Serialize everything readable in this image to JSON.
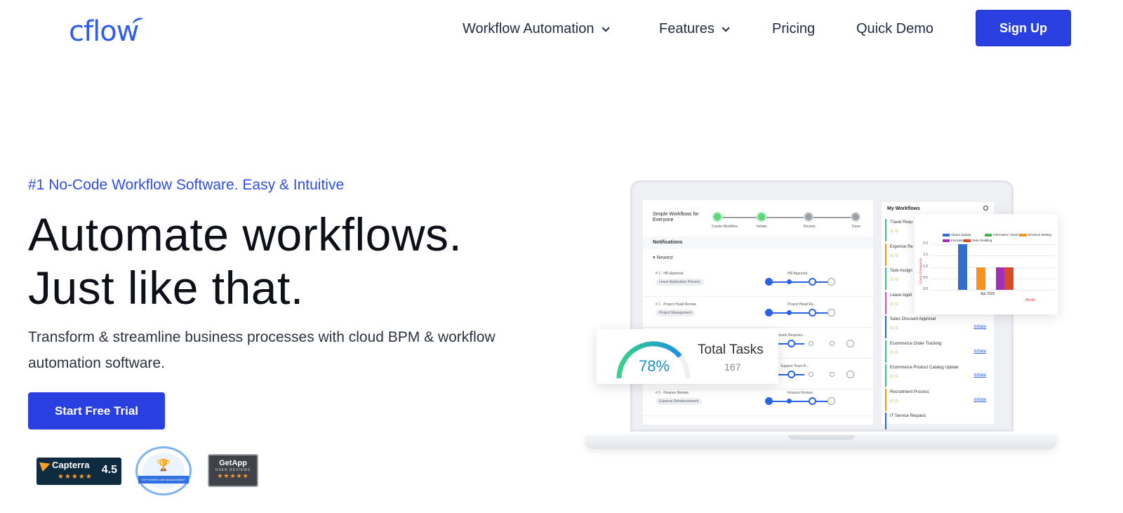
{
  "brand": {
    "logo_text": "cflow",
    "accent": "#2a3fe0"
  },
  "nav": {
    "items": [
      {
        "label": "Workflow Automation",
        "dropdown": true
      },
      {
        "label": "Features",
        "dropdown": true
      },
      {
        "label": "Pricing",
        "dropdown": false
      },
      {
        "label": "Quick Demo",
        "dropdown": false
      }
    ],
    "signup_label": "Sign Up"
  },
  "hero": {
    "eyebrow": "#1 No-Code Workflow Software. Easy & Intuitive",
    "headline_line1": "Automate workflows.",
    "headline_line2": "Just like that.",
    "subtext": "Transform & streamline business processes with cloud BPM & workflow automation software.",
    "cta_label": "Start Free Trial"
  },
  "badges": {
    "capterra": {
      "name": "Capterra",
      "score": "4.5",
      "stars": "★★★★★"
    },
    "g2": {
      "ribbon": "TOP WORKFLOW MANAGEMENT SOFTWARE"
    },
    "getapp": {
      "name": "GetApp",
      "sub": "USER REVIEWS",
      "stars": "★★★★★"
    }
  },
  "dashboard": {
    "steps_title": "Simple Workflows for Everyone",
    "steps": [
      "Create Workflow",
      "Initiate",
      "Review",
      "Done"
    ],
    "notifications_label": "Notifications",
    "newest_label": "Newest",
    "notifications": [
      {
        "title": "# 1 - HR Approval",
        "tag": "Leave Application Process",
        "stage": "HR Approval"
      },
      {
        "title": "# 1 - Project Head Review",
        "tag": "Project Management",
        "stage": "Project Head Re..."
      },
      {
        "title": "",
        "tag": "",
        "stage": "Person Respons..."
      },
      {
        "title": "",
        "tag": "",
        "stage": "Support Team R..."
      },
      {
        "title": "# 1 - Finance Review",
        "tag": "Expense Reimbursement",
        "stage": "Finance Review"
      }
    ],
    "my_workflows_label": "My Workflows",
    "workflows": [
      {
        "name": "Travel Requ",
        "initiate": ""
      },
      {
        "name": "Expense Re",
        "initiate": ""
      },
      {
        "name": "Task Assign",
        "initiate": ""
      },
      {
        "name": "Leave Appli",
        "initiate": ""
      },
      {
        "name": "Sales Discount Approval",
        "initiate": "Initiate"
      },
      {
        "name": "Ecommerce Order Tracking",
        "initiate": "Initiate"
      },
      {
        "name": "Ecommerce Product Catalog Update",
        "initiate": "Initiate"
      },
      {
        "name": "Recruitment Process",
        "initiate": "Initiate"
      },
      {
        "name": "IT Service Request",
        "initiate": ""
      }
    ]
  },
  "tasks_card": {
    "percent": "78%",
    "percent_value": 78,
    "title": "Total Tasks",
    "count": "167"
  },
  "chart_data": {
    "type": "bar",
    "title": "",
    "categories": [
      "Apr 2020"
    ],
    "series": [
      {
        "name": "Status Update",
        "values": [
          2.0
        ],
        "color": "#2f6fd0"
      },
      {
        "name": "Information Sharing",
        "values": [
          0
        ],
        "color": "#3fb54a"
      },
      {
        "name": "Decision Making",
        "values": [
          1.0
        ],
        "color": "#f7941d"
      },
      {
        "name": "Innovation",
        "values": [
          1.0
        ],
        "color": "#a12fb8"
      },
      {
        "name": "Team Building",
        "values": [
          1.0
        ],
        "color": "#d64a2a"
      }
    ],
    "xlabel": "Month",
    "ylabel": "Count of Requests",
    "yticks": [
      "2.0",
      "1.5",
      "1.0",
      "0.5",
      "0.0"
    ],
    "ylim": [
      0,
      2
    ],
    "grid": true,
    "legend": "top"
  }
}
